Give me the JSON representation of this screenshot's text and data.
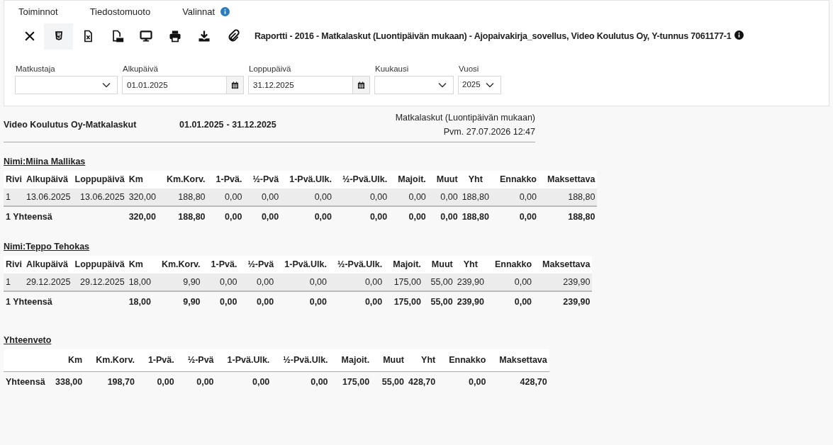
{
  "menu": [
    {
      "label": "Toiminnot",
      "info": false
    },
    {
      "label": "Tiedostomuoto",
      "info": false
    },
    {
      "label": "Valinnat",
      "info": true
    }
  ],
  "toolbar": [
    {
      "kind": "close",
      "selected": false
    },
    {
      "kind": "html",
      "selected": true
    },
    {
      "kind": "excel",
      "selected": false
    },
    {
      "kind": "pdf",
      "selected": false
    },
    {
      "kind": "screen",
      "selected": false
    },
    {
      "kind": "print",
      "selected": false
    },
    {
      "kind": "download",
      "selected": false
    },
    {
      "kind": "attach",
      "selected": false
    }
  ],
  "report_title": "Raportti - 2016 - Matkalaskut (Luontipäivän mukaan) - Ajopaivakirja_sovellus, Video Koulutus Oy, Y-tunnus 7061177-1",
  "filters": [
    {
      "kind": "select",
      "label": "Matkustaja"
    },
    {
      "kind": "date",
      "label": "Alkupäivä",
      "value": "01.01.2025"
    },
    {
      "kind": "date",
      "label": "Loppupäivä",
      "value": "31.12.2025"
    },
    {
      "kind": "select",
      "label": "Kuukausi"
    },
    {
      "kind": "select",
      "label": "Vuosi",
      "value": "2025"
    }
  ],
  "report": {
    "company": "Video Koulutus Oy-Matkalaskut",
    "start": "01.01.2025",
    "end": "- 31.12.2025",
    "type": "Matkalaskut (Luontipäivän mukaan)",
    "printed": "Pvm. 27.07.2026 12:47"
  },
  "persons": [
    {
      "name": "Nimi:Miina Mallikas",
      "columns": [
        "Rivi",
        "Alkupäivä",
        "Loppupäivä",
        "Km",
        "Km.Korv.",
        "1-Pvä.",
        "½-Pvä",
        "1-Pvä.Ulk.",
        "½-Pvä.Ulk.",
        "Majoit.",
        "Muut",
        "Yht",
        "Ennakko",
        "Maksettava"
      ],
      "rows": [
        [
          "1",
          "13.06.2025",
          "13.06.2025",
          "320,00",
          "188,80",
          "0,00",
          "0,00",
          "0,00",
          "0,00",
          "0,00",
          "0,00",
          "188,80",
          "0,00",
          "188,80"
        ]
      ],
      "total": {
        "label": "1 Yhteensä",
        "values": [
          "320,00",
          "188,80",
          "0,00",
          "0,00",
          "0,00",
          "0,00",
          "0,00",
          "0,00",
          "188,80",
          "0,00",
          "188,80"
        ]
      }
    },
    {
      "name": "Nimi:Teppo Tehokas",
      "columns": [
        "Rivi",
        "Alkupäivä",
        "Loppupäivä",
        "Km",
        "Km.Korv.",
        "1-Pvä.",
        "½-Pvä",
        "1-Pvä.Ulk.",
        "½-Pvä.Ulk.",
        "Majoit.",
        "Muut",
        "Yht",
        "Ennakko",
        "Maksettava"
      ],
      "rows": [
        [
          "1",
          "29.12.2025",
          "29.12.2025",
          "18,00",
          "9,90",
          "0,00",
          "0,00",
          "0,00",
          "0,00",
          "175,00",
          "55,00",
          "239,90",
          "0,00",
          "239,90"
        ]
      ],
      "total": {
        "label": "1 Yhteensä",
        "values": [
          "18,00",
          "9,90",
          "0,00",
          "0,00",
          "0,00",
          "0,00",
          "175,00",
          "55,00",
          "239,90",
          "0,00",
          "239,90"
        ]
      }
    }
  ],
  "summary": {
    "title": "Yhteenveto",
    "columns": [
      "Km",
      "Km.Korv.",
      "1-Pvä.",
      "½-Pvä",
      "1-Pvä.Ulk.",
      "½-Pvä.Ulk.",
      "Majoit.",
      "Muut",
      "Yht",
      "Ennakko",
      "Maksettava"
    ],
    "label": "Yhteensä",
    "values": [
      "338,00",
      "198,70",
      "0,00",
      "0,00",
      "0,00",
      "0,00",
      "175,00",
      "55,00",
      "428,70",
      "0,00",
      "428,70"
    ]
  }
}
